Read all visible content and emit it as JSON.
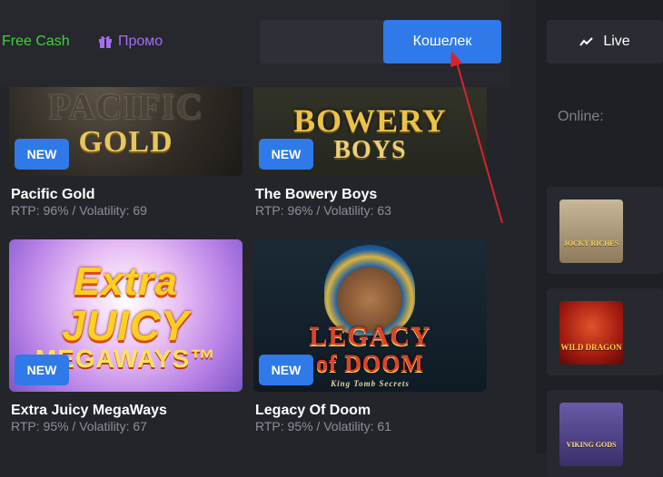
{
  "nav": {
    "free_cash": "Free Cash",
    "promo": "Промо",
    "wallet_button": "Кошелек"
  },
  "games": [
    {
      "title": "Pacific Gold",
      "meta": "RTP: 96% / Volatility: 69",
      "badge": "NEW",
      "art_line1": "PACIFIC",
      "art_line2": "GOLD"
    },
    {
      "title": "The Bowery Boys",
      "meta": "RTP: 96% / Volatility: 63",
      "badge": "NEW",
      "art_line1": "BOWERY",
      "art_line2": "BOYS"
    },
    {
      "title": "Extra Juicy MegaWays",
      "meta": "RTP: 95% / Volatility: 67",
      "badge": "NEW",
      "art_line1": "Extra",
      "art_line2": "JUICY",
      "art_line3": "MEGAWAYS™"
    },
    {
      "title": "Legacy Of Doom",
      "meta": "RTP: 95% / Volatility: 61",
      "badge": "NEW",
      "art_line1": "LEGACY",
      "art_line2": "of DOOM",
      "art_line3": "King Tomb Secrets"
    }
  ],
  "sidebar": {
    "live_label": "Live",
    "online_label": "Online:",
    "thumbs": [
      {
        "label": "JOCKY RICHES"
      },
      {
        "label": "WILD DRAGON"
      },
      {
        "label": "VIKING GODS"
      }
    ]
  },
  "colors": {
    "accent_blue": "#2f7ae8",
    "free_cash_green": "#3dd23a",
    "promo_purple": "#a66cf2",
    "annotation_arrow": "#d9232a"
  }
}
